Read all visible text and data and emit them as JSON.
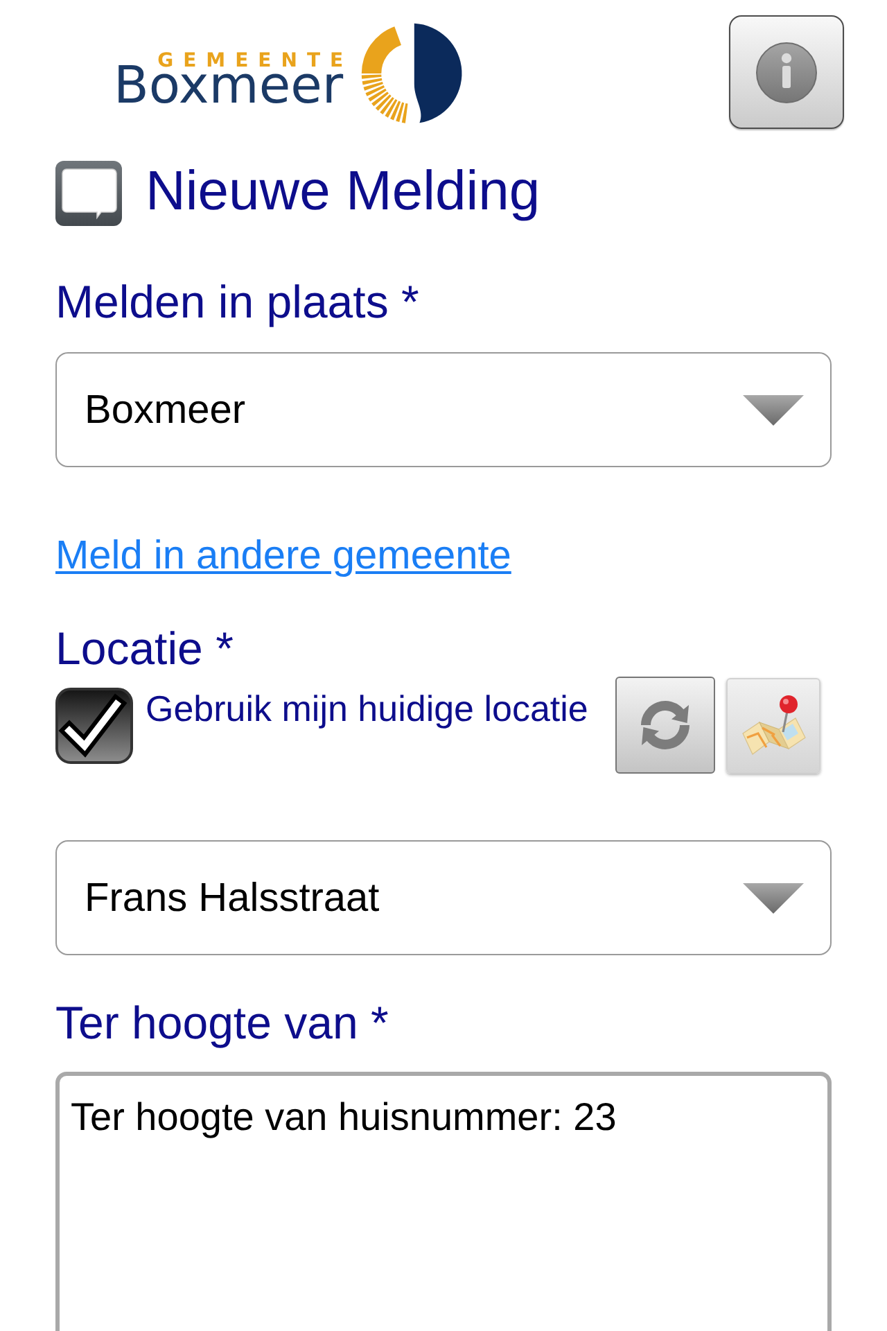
{
  "header": {
    "logo": {
      "subtitle": "GEMEENTE",
      "name": "Boxmeer"
    }
  },
  "title": "Nieuwe Melding",
  "place": {
    "label": "Melden in plaats *",
    "value": "Boxmeer"
  },
  "other_municipality_link": "Meld in andere gemeente",
  "location": {
    "label": "Locatie *",
    "use_current": {
      "label": "Gebruik mijn huidige locatie",
      "checked": true
    },
    "street": "Frans Halsstraat"
  },
  "near": {
    "label": "Ter hoogte van *",
    "value": "Ter hoogte van huisnummer: 23"
  }
}
